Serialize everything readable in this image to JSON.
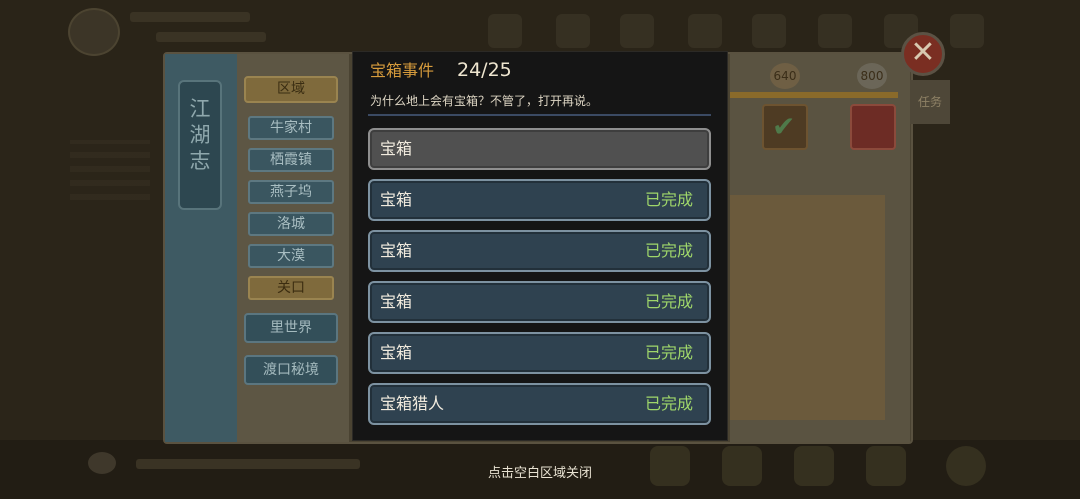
{
  "modal": {
    "title": "宝箱事件",
    "count": "24/25",
    "description": "为什么地上会有宝箱？不管了，打开再说。",
    "rows": [
      {
        "name": "宝箱",
        "status": ""
      },
      {
        "name": "宝箱",
        "status": "已完成"
      },
      {
        "name": "宝箱",
        "status": "已完成"
      },
      {
        "name": "宝箱",
        "status": "已完成"
      },
      {
        "name": "宝箱",
        "status": "已完成"
      },
      {
        "name": "宝箱猎人",
        "status": "已完成"
      }
    ],
    "close_hint": "点击空白区域关闭"
  },
  "background": {
    "banner_title": "江湖志",
    "region_header": "区域",
    "regions": [
      "牛家村",
      "栖霞镇",
      "燕子坞",
      "洛城",
      "大漠",
      "关口"
    ],
    "active_region": "关口",
    "other_worlds": [
      "里世界",
      "渡口秘境"
    ],
    "scores": [
      "640",
      "800"
    ],
    "side_tab": "任务"
  },
  "colors": {
    "completed": "#9fd66a",
    "title_accent": "#d69b3c",
    "row_fill": "#2f4250",
    "pending_fill": "#505050"
  },
  "icons": {
    "close": "close-icon",
    "check": "check-icon"
  }
}
